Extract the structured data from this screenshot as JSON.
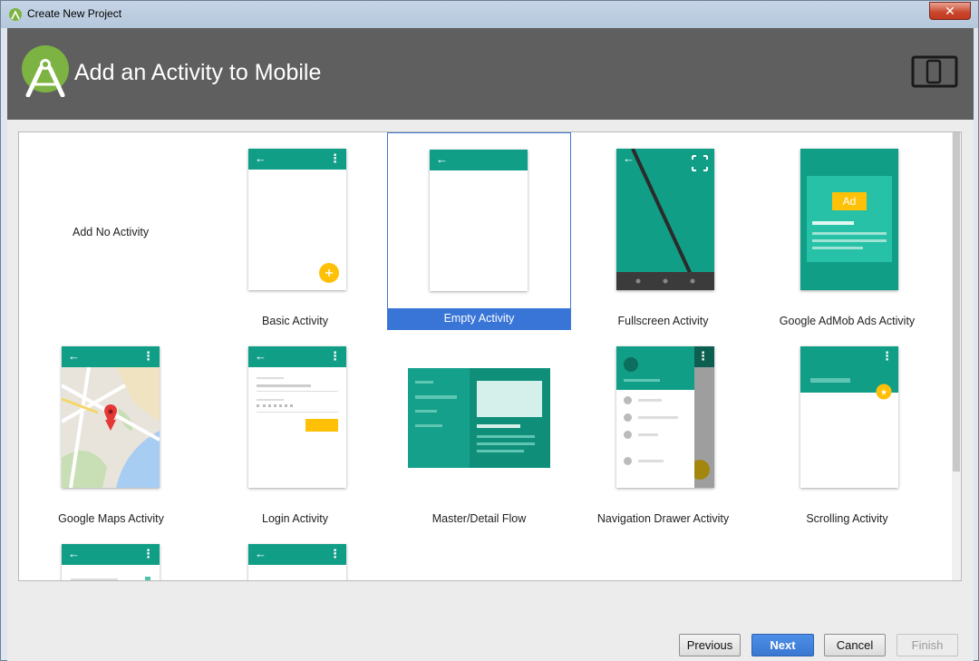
{
  "window": {
    "title": "Create New Project",
    "close_glyph": "✕"
  },
  "header": {
    "title": "Add an Activity to Mobile",
    "logo_icon": "android-studio-icon",
    "device_icon": "phone-tablet-icon"
  },
  "colors": {
    "accent": "#119e87",
    "header_bg": "#5f5f5f",
    "selection": "#3875d7",
    "fab": "#ffc107"
  },
  "gallery": {
    "selected": "Empty Activity",
    "tiles": [
      {
        "label": "Add No Activity"
      },
      {
        "label": "Basic Activity"
      },
      {
        "label": "Empty Activity"
      },
      {
        "label": "Fullscreen Activity"
      },
      {
        "label": "Google AdMob Ads Activity",
        "ad_badge": "Ad"
      },
      {
        "label": "Google Maps Activity"
      },
      {
        "label": "Login Activity"
      },
      {
        "label": "Master/Detail Flow"
      },
      {
        "label": "Navigation Drawer Activity"
      },
      {
        "label": "Scrolling Activity"
      }
    ]
  },
  "buttons": {
    "previous": "Previous",
    "next": "Next",
    "cancel": "Cancel",
    "finish": "Finish"
  }
}
